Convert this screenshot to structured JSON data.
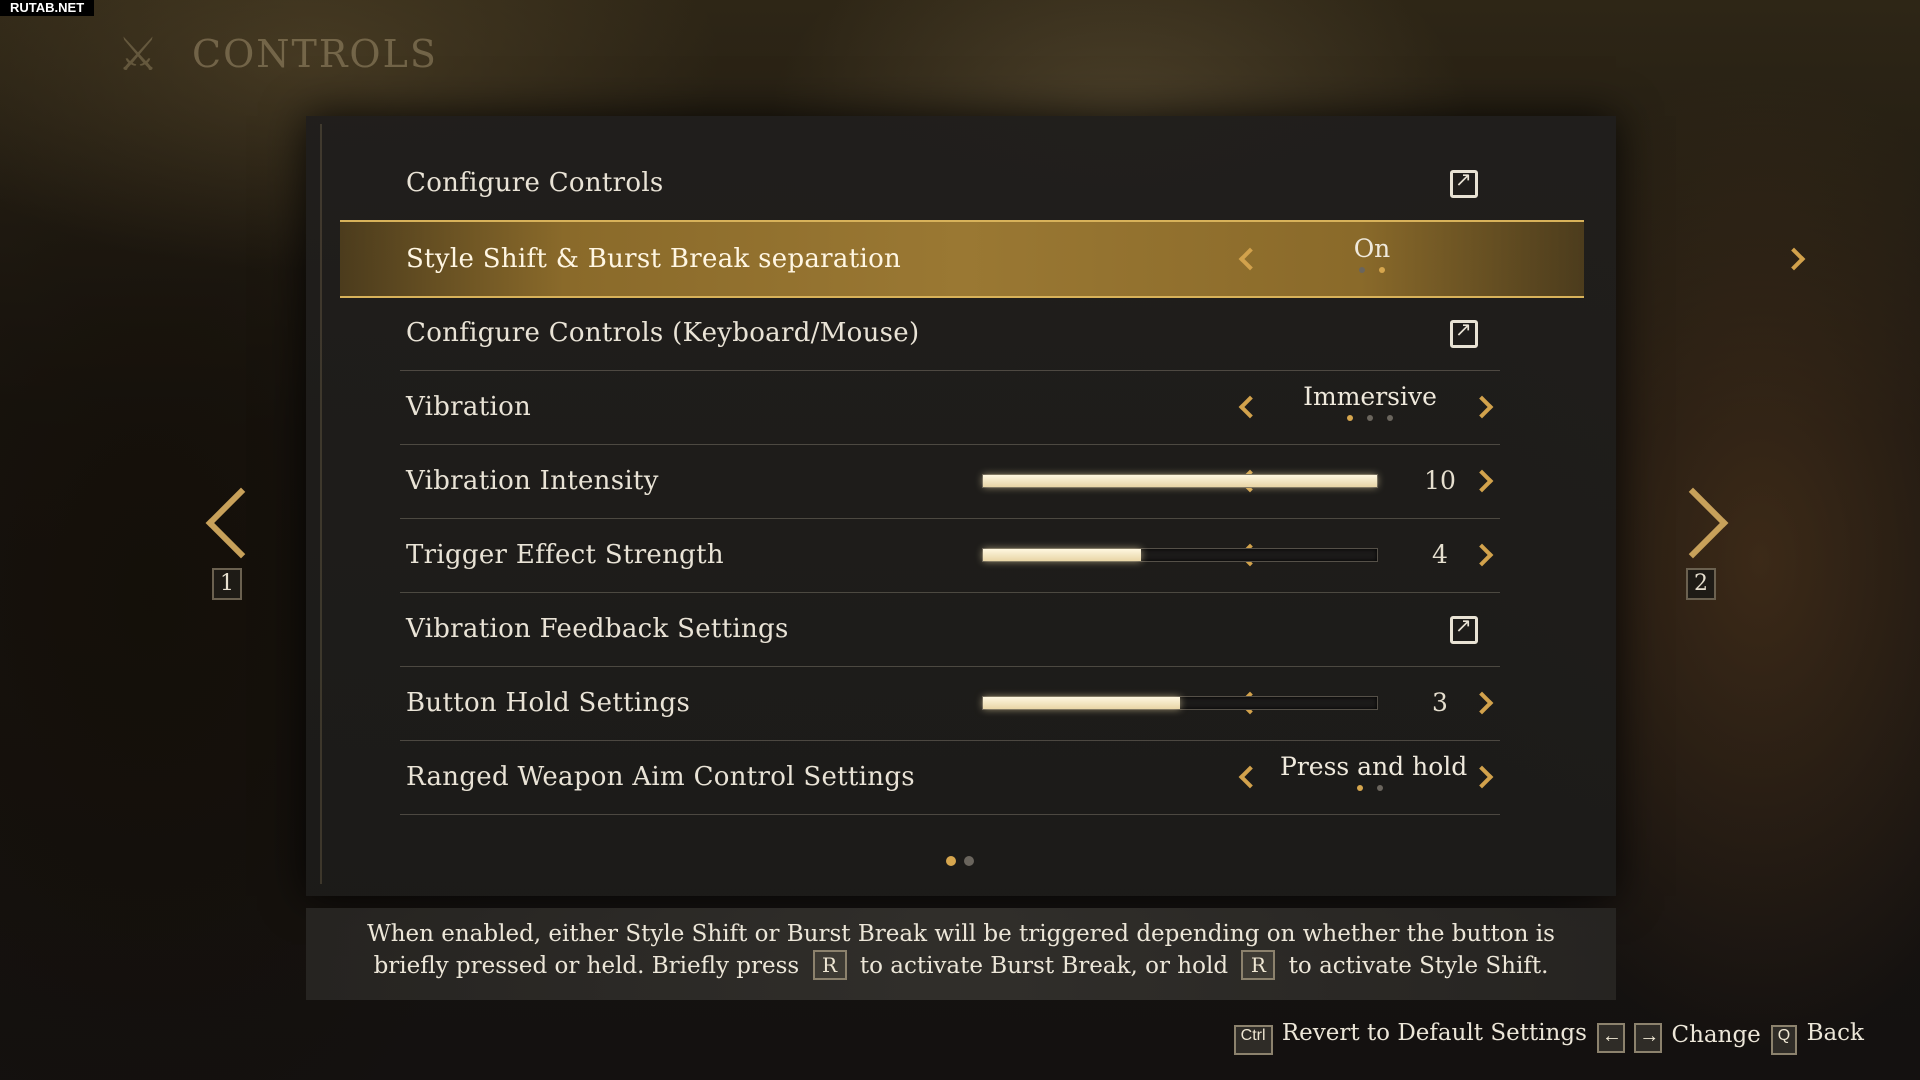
{
  "watermark": "RUTAB.NET",
  "header": {
    "title": "CONTROLS",
    "emblem_icon": "crossed-weapons-icon"
  },
  "rows": [
    {
      "label": "Configure Controls",
      "type": "link",
      "icon": "external-link-icon"
    },
    {
      "label": "Style Shift & Burst Break separation",
      "type": "option",
      "value": "On",
      "option_count": 2,
      "option_index": 1,
      "selected": true
    },
    {
      "label": "Configure Controls (Keyboard/Mouse)",
      "type": "link",
      "icon": "external-link-icon"
    },
    {
      "label": "Vibration",
      "type": "option",
      "value": "Immersive",
      "option_count": 3,
      "option_index": 0
    },
    {
      "label": "Vibration Intensity",
      "type": "slider",
      "value": "10",
      "fill_fraction": 1.0
    },
    {
      "label": "Trigger Effect Strength",
      "type": "slider",
      "value": "4",
      "fill_fraction": 0.4
    },
    {
      "label": "Vibration Feedback Settings",
      "type": "link",
      "icon": "external-link-icon"
    },
    {
      "label": "Button Hold Settings",
      "type": "slider",
      "value": "3",
      "fill_fraction": 0.5
    },
    {
      "label": "Ranged Weapon Aim Control Settings",
      "type": "option",
      "value": "Press and hold",
      "option_count": 2,
      "option_index": 0
    }
  ],
  "pagination": {
    "current": 1,
    "total": 2,
    "prev_page": "1",
    "next_page": "2"
  },
  "description": {
    "line1": "When enabled, either Style Shift or Burst Break will be triggered depending on whether the button is",
    "line2_a": "briefly pressed or held. Briefly press",
    "key1": "R",
    "line2_b": "to activate Burst Break, or hold",
    "key2": "R",
    "line2_c": "to activate Style Shift."
  },
  "footer": {
    "revert_key": "Ctrl",
    "revert_label": "Revert to Default Settings",
    "change_key_left": "←",
    "change_key_right": "→",
    "change_label": "Change",
    "back_key": "Q",
    "back_label": "Back"
  },
  "colors": {
    "accent": "#d2a24c",
    "selected_bg": "#9a7833",
    "panel_bg": "#201e1c"
  }
}
